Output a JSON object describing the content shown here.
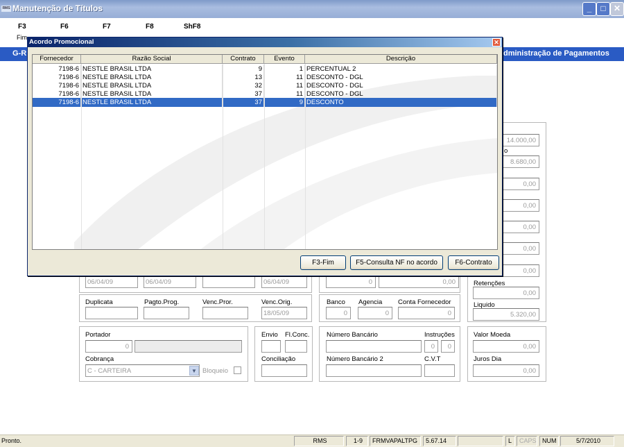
{
  "window": {
    "title": "Manutenção de Títulos",
    "app_icon": "RMS",
    "min": "_",
    "max": "□",
    "close": "✕"
  },
  "toolbar": {
    "keys": [
      "F3",
      "F6",
      "F7",
      "F8",
      "ShF8"
    ],
    "f3_sub": "Fim"
  },
  "header_bar": {
    "left": "G-R",
    "right": "dministração de Pagamentos"
  },
  "form": {
    "right_values": [
      "14.000,00",
      "8.680,00",
      "0,00",
      "0,00",
      "0,00",
      "0,00",
      "0,00"
    ],
    "right_partial_label": "o",
    "dates": [
      "06/04/09",
      "06/04/09",
      "",
      "06/04/09"
    ],
    "mid_values": [
      "0",
      "0,00"
    ],
    "retencoes_label": "Retenções",
    "retencoes_value": "0,00",
    "liquido_label": "Liquido",
    "liquido_value": "5.320,00",
    "duplicata": "Duplicata",
    "pagto_prog": "Pagto.Prog.",
    "venc_pror": "Venc.Pror.",
    "venc_orig": "Venc.Orig.",
    "venc_orig_value": "18/05/09",
    "banco": "Banco",
    "agencia": "Agencia",
    "conta_fornecedor": "Conta Fornecedor",
    "banco_value": "0",
    "agencia_value": "0",
    "conta_value": "0",
    "portador": "Portador",
    "portador_value": "0",
    "envio": "Envio",
    "fl_conc": "Fl.Conc.",
    "numero_bancario": "Número Bancário",
    "instrucoes": "Instruções",
    "instr1": "0",
    "instr2": "0",
    "valor_moeda": "Valor Moeda",
    "valor_moeda_value": "0,00",
    "cobranca": "Cobrança",
    "cobranca_value": "C - CARTEIRA",
    "bloqueio": "Bloqueio",
    "conciliacao": "Conciliação",
    "numero_bancario_2": "Número Bancário 2",
    "cvt": "C.V.T",
    "juros_dia": "Juros Dia",
    "juros_dia_value": "0,00"
  },
  "dialog": {
    "title": "Acordo Promocional",
    "columns": [
      "Fornecedor",
      "Razão Social",
      "Contrato",
      "Evento",
      "Descrição"
    ],
    "rows": [
      [
        "7198-6",
        "NESTLE BRASIL LTDA",
        "9",
        "1",
        "PERCENTUAL 2"
      ],
      [
        "7198-6",
        "NESTLE BRASIL LTDA",
        "13",
        "11",
        "DESCONTO - DGL"
      ],
      [
        "7198-6",
        "NESTLE BRASIL LTDA",
        "32",
        "11",
        "DESCONTO - DGL"
      ],
      [
        "7198-6",
        "NESTLE BRASIL LTDA",
        "37",
        "11",
        "DESCONTO - DGL"
      ],
      [
        "7198-6",
        "NESTLE BRASIL LTDA",
        "37",
        "9",
        "DESCONTO"
      ]
    ],
    "selected_row": 4,
    "buttons": [
      "F3-Fim",
      "F5-Consulta NF no acordo",
      "F6-Contrato"
    ]
  },
  "status": {
    "text": "Pronto.",
    "cells": [
      "RMS",
      "1-9",
      "FRMVAPALTPG",
      "5.67.14",
      "",
      "L",
      "CAPS",
      "NUM",
      "5/7/2010"
    ]
  }
}
